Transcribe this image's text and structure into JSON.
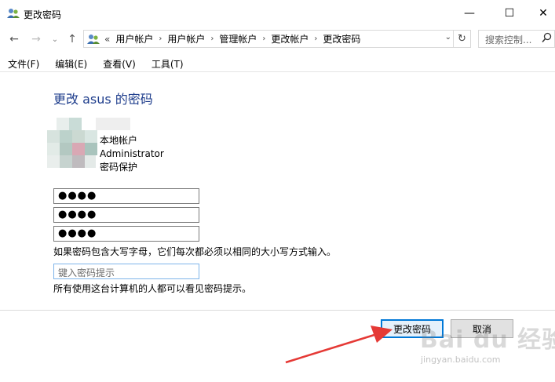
{
  "window": {
    "title": "更改密码",
    "minimize_glyph": "—",
    "maximize_glyph": "☐",
    "close_glyph": "✕"
  },
  "nav": {
    "back_glyph": "←",
    "forward_glyph": "→",
    "recent_glyph": "⌄",
    "up_glyph": "↑",
    "overflow_glyph": "«",
    "breadcrumbs": [
      "用户帐户",
      "用户帐户",
      "管理帐户",
      "更改帐户",
      "更改密码"
    ],
    "crumb_sep_glyph": "›",
    "dropdown_glyph": "⌄",
    "refresh_glyph": "↻",
    "search_placeholder": "搜索控制..."
  },
  "menu": {
    "items": [
      "文件(F)",
      "编辑(E)",
      "查看(V)",
      "工具(T)"
    ]
  },
  "main": {
    "heading": "更改 asus 的密码",
    "account_lines": [
      "本地帐户",
      "Administrator",
      "密码保护"
    ],
    "password_fields": [
      "●●●●",
      "●●●●",
      "●●●●"
    ],
    "case_note": "如果密码包含大写字母，它们每次都必须以相同的大小写方式输入。",
    "hint_placeholder": "键入密码提示",
    "hint_note": "所有使用这台计算机的人都可以看见密码提示。"
  },
  "buttons": {
    "change_password": "更改密码",
    "cancel": "取消"
  },
  "watermark": {
    "brand": "Bai du 经验",
    "url": "jingyan.baidu.com"
  },
  "colors": {
    "heading": "#1e3d8c",
    "primary_border": "#0078d7",
    "annotation_arrow": "#e53935"
  }
}
